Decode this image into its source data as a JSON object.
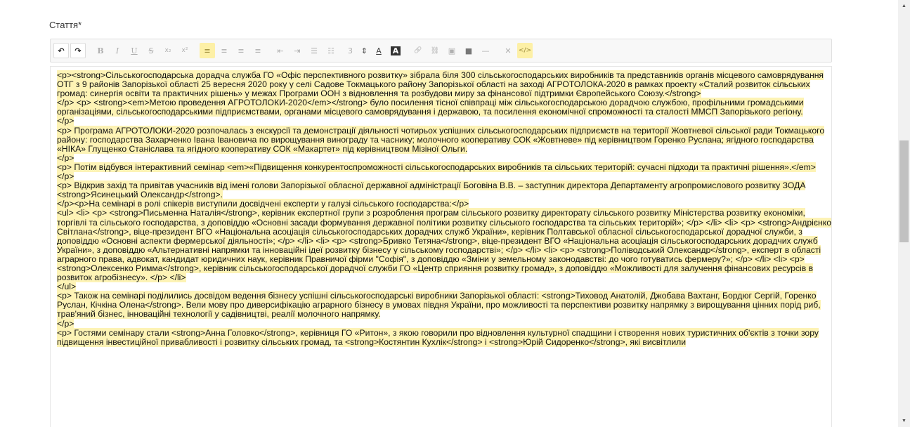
{
  "field_label": "Стаття*",
  "toolbar": {
    "buttons": [
      {
        "name": "undo-icon",
        "glyph": "↶"
      },
      {
        "name": "redo-icon",
        "glyph": "↷"
      },
      {
        "name": "bold-icon",
        "glyph": "B"
      },
      {
        "name": "italic-icon",
        "glyph": "I"
      },
      {
        "name": "underline-icon",
        "glyph": "U"
      },
      {
        "name": "strikethrough-icon",
        "glyph": "S"
      },
      {
        "name": "subscript-icon",
        "glyph": "x₂"
      },
      {
        "name": "superscript-icon",
        "glyph": "x²"
      },
      {
        "name": "align-left-icon",
        "glyph": "≡"
      },
      {
        "name": "align-center-icon",
        "glyph": "≡"
      },
      {
        "name": "align-right-icon",
        "glyph": "≡"
      },
      {
        "name": "justify-icon",
        "glyph": "≡"
      },
      {
        "name": "outdent-icon",
        "glyph": "⇤"
      },
      {
        "name": "indent-icon",
        "glyph": "⇥"
      },
      {
        "name": "bullet-list-icon",
        "glyph": "☰"
      },
      {
        "name": "numbered-list-icon",
        "glyph": "☷"
      },
      {
        "name": "font-size-value",
        "glyph": "3"
      },
      {
        "name": "font-size-stepper-icon",
        "glyph": "⇕"
      },
      {
        "name": "text-color-icon",
        "glyph": "A"
      },
      {
        "name": "background-color-icon",
        "glyph": "A"
      },
      {
        "name": "link-icon",
        "glyph": "🔗"
      },
      {
        "name": "unlink-icon",
        "glyph": "⛓"
      },
      {
        "name": "image-icon",
        "glyph": "▣"
      },
      {
        "name": "video-icon",
        "glyph": "■"
      },
      {
        "name": "horizontal-rule-icon",
        "glyph": "—"
      },
      {
        "name": "clear-format-icon",
        "glyph": "✕"
      },
      {
        "name": "source-code-icon",
        "glyph": "</>"
      }
    ]
  },
  "editor": {
    "lines": [
      "<p><strong>Сільськогосподарська дорадча служба ГО «Офіс перспективного розвитку» зібрала біля 300 сільськогосподарських виробників та представників органів місцевого самоврядування ОТГ з 9 районів Запорізької області 25 вересня 2020 року у селі Садове Токмацького району Запорізької області на заході АГРОТОЛОКА-2020 в рамках проекту «Сталий розвиток сільських громад: синергія освіти та практичних рішень» у межах Програми ООН з відновлення та розбудови миру за фінансової підтримки Європейського Союзу.</strong>",
      "</p> <p> <strong><em>Метою проведення АГРОТОЛОКИ-2020</em></strong> було посилення тісної співпраці між сільськогосподарською дорадчою службою, профільними громадськими організаціями, сільськогосподарськими підприємствами, органами місцевого самоврядування і державою, та посилення економічної спроможності та сталості ММСП Запорізького регіону.",
      "</p>",
      "<p> Програма АГРОТОЛОКИ-2020 розпочалась з екскурсії та демонстрації діяльності чотирьох успішних сільськогосподарських підприємств на території Жовтневої сільської ради Токмацького району: господарства Захарченко Івана Івановича по вирощування винограду та часнику; молочного кооперативу СОК «Жовтневе» під керівництвом Горенко Руслана; ягідного господарства «НІКА» Глущенко Станіслава та ягідного кооперативу СОК «Макартет» під керівництвом Мізіної Ольги.",
      "</p>",
      "<p> Потім відбувся інтерактивний семінар <em>«Підвищення конкурентоспроможності сільськогосподарських виробників та сільських територій: сучасні підходи та практичні рішення».</em>",
      "</p>",
      "<p> Відкрив захід та привітав учасників від імені голови Запорізької обласної державної адміністрації Боговіна В.В. – заступник директора Департаменту агропромислового розвитку ЗОДА <strong>Ясинецький Олександр</strong>.",
      "</p><p>На семінарі в ролі спікерів виступили досвідчені експерти у галузі сільського господарства:</p>",
      "<ul> <li> <p> <strong>Письменна Наталія</strong>, керівник експертної групи з розроблення програм сільського розвитку директорату сільського розвитку Міністерства розвитку економіки, торгівлі та сільського господарства, з доповіддю «Основні засади формування державної політики розвитку сільського господарства та сільських територій»; </p> </li> <li> <p> <strong>Андрієнко Світлана</strong>, віце-президент ВГО «Національна асоціація сільськогосподарських дорадчих служб України», керівник Полтавської обласної сільськогосподарської дорадчої служби, з доповіддю «Основні аспекти фермерської діяльності»; </p> </li> <li> <p> <strong>Бривко Тетяна</strong>, віце-президент ВГО «Національна асоціація сільськогосподарських дорадчих служб України», з доповіддю «Альтернативні напрямки та інноваційні ідеї розвитку бізнесу у сільському господарстві»; </p> </li> <li> <p> <strong>Поліводський Олександр</strong>, експерт в області аграрного права, адвокат, кандидат юридичних наук, керівник Правничої фірми \"Софія\", з доповіддю «Зміни у земельному законодавстві: до чого готуватись фермеру?»; </p> </li> <li> <p> <strong>Олексенко Римма</strong>, керівник сільськогосподарської дорадчої служби ГО «Центр сприяння розвитку громад», з доповіддю «Можливості для залучення фінансових ресурсів в розвиток агробізнесу». </p> </li>",
      "</ul>",
      "<p> Також на семінарі поділились досвідом ведення бізнесу успішні сільськогосподарські виробники Запорізької області: <strong>Тиховод Анатолій, Джобава Вахтанг, Бордюг Сергій, Горенко Руслан, Кічкіна Олена</strong>. Вели мову про диверсифікацію аграрного бізнесу в умовах півдня України, про можливості та перспективи розвитку напрямку з вирощування цінних порід риб, трав'яний бізнес, інноваційні технології у садівництві, реалії молочного напрямку.",
      "</p>",
      "<p> Гостями семінару стали <strong>Анна Головко</strong>, керівниця ГО «Ритон», з якою говорили про відновлення культурної спадщини і створення нових туристичних об'єктів з точки зору підвищення інвестиційної привабливості і розвитку сільських громад, та <strong>Костянтин Кухлік</strong> і <strong>Юрій Сидоренко</strong>, які висвітлили"
    ]
  },
  "colors": {
    "highlight": "#fdf3b5",
    "active_button": "#fdf0a6"
  }
}
